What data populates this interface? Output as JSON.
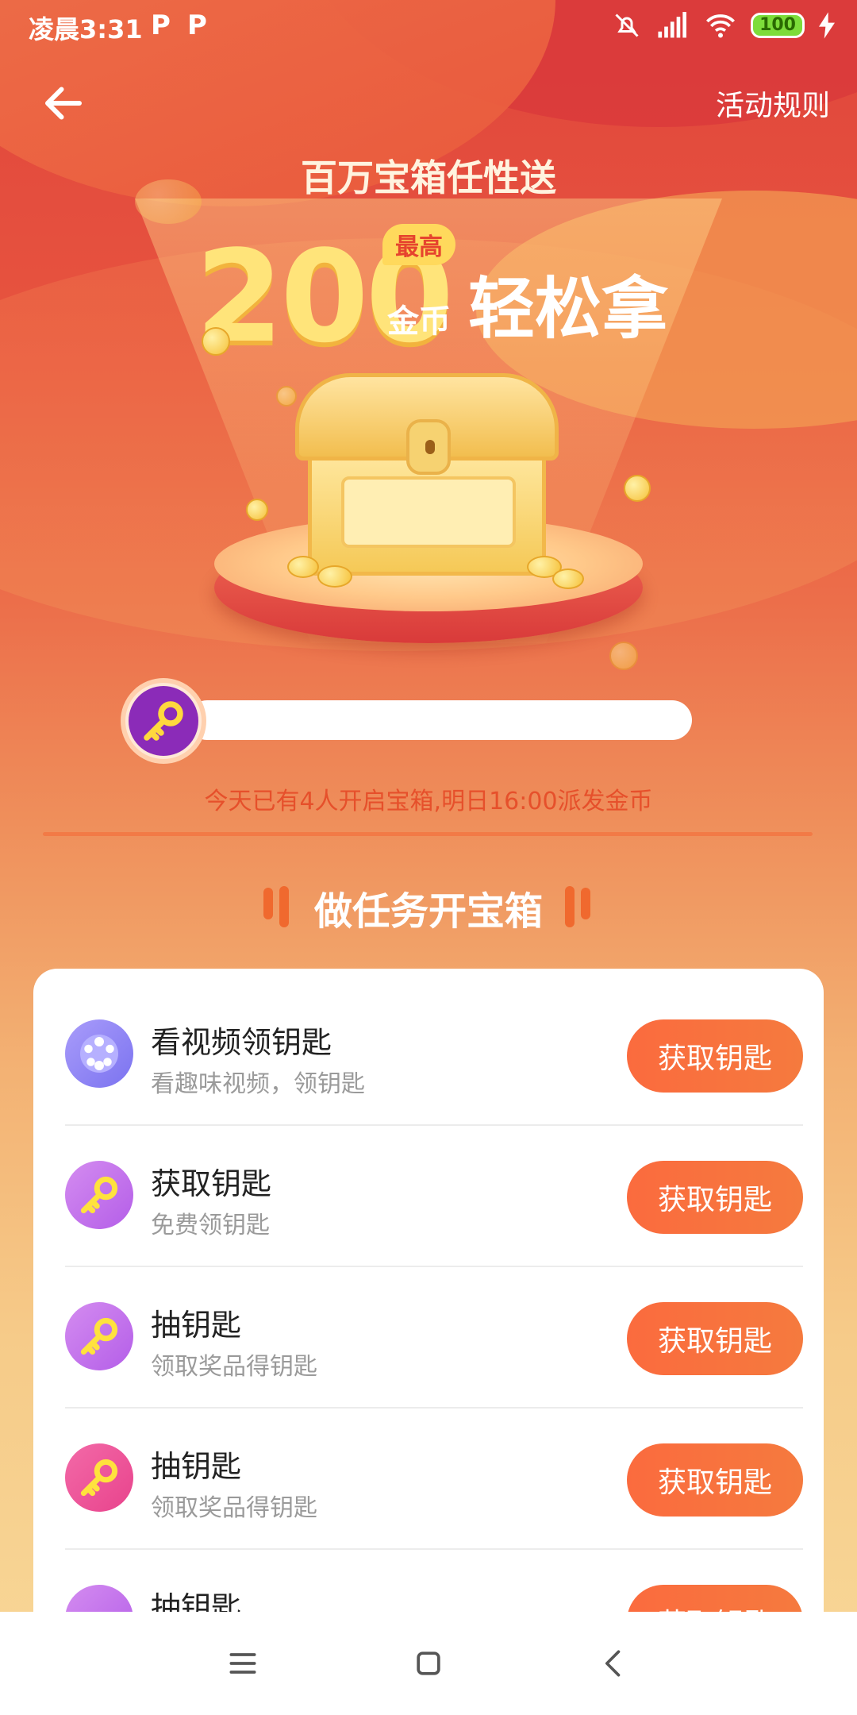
{
  "status_bar": {
    "time": "凌晨3:31",
    "notif_icons": [
      "P",
      "P"
    ],
    "battery": "100"
  },
  "header": {
    "rules_link": "活动规则"
  },
  "hero": {
    "title": "百万宝箱任性送",
    "amount": "200",
    "badge": "最高",
    "unit": "金币",
    "slogan": "轻松拿"
  },
  "progress": {
    "value": 0
  },
  "notice": "今天已有4人开启宝箱,明日16:00派发金币",
  "section": {
    "title": "做任务开宝箱"
  },
  "tasks": [
    {
      "name": "看视频领钥匙",
      "desc": "看趣味视频，领钥匙",
      "button": "获取钥匙",
      "icon": "film-reel-icon"
    },
    {
      "name": "获取钥匙",
      "desc": "免费领钥匙",
      "button": "获取钥匙",
      "icon": "key-icon"
    },
    {
      "name": "抽钥匙",
      "desc": "领取奖品得钥匙",
      "button": "获取钥匙",
      "icon": "key-icon"
    },
    {
      "name": "抽钥匙",
      "desc": "领取奖品得钥匙",
      "button": "获取钥匙",
      "icon": "key-icon"
    },
    {
      "name": "抽钥匙",
      "desc": "",
      "button": "获取钥匙",
      "icon": "key-icon"
    }
  ],
  "colors": {
    "accent": "#f76a3c",
    "notice": "#e6502b"
  }
}
